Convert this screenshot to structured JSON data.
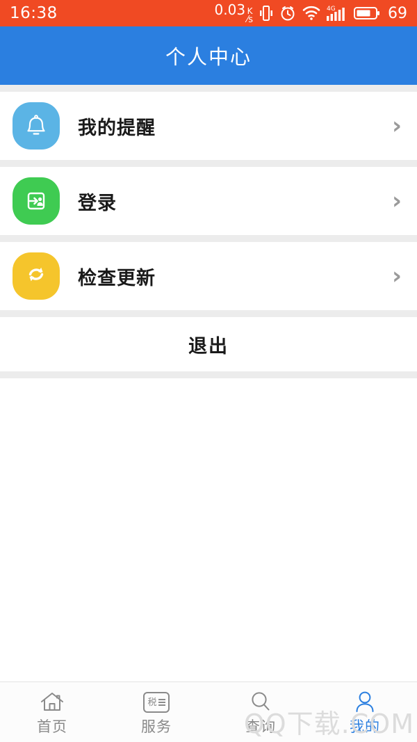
{
  "status_bar": {
    "time": "16:38",
    "network_speed_value": "0.03",
    "network_speed_unit_top": "K",
    "network_speed_unit_bottom": "s",
    "icons": [
      "vibrate-icon",
      "alarm-icon",
      "wifi-icon",
      "signal-4g-icon",
      "battery-icon"
    ],
    "signal_label": "4G",
    "battery_percent": "69",
    "background_color": "#F04A23",
    "text_color": "#FFFFFF"
  },
  "header": {
    "title": "个人中心",
    "background_color": "#2B7FE0",
    "text_color": "#FFFFFF"
  },
  "list": {
    "items": [
      {
        "label": "我的提醒",
        "icon": "bell-icon",
        "icon_color": "#5BB4E5",
        "chevron": "›"
      },
      {
        "label": "登录",
        "icon": "login-person-icon",
        "icon_color": "#3FCB52",
        "chevron": "›"
      },
      {
        "label": "检查更新",
        "icon": "refresh-icon",
        "icon_color": "#F5C52C",
        "chevron": "›"
      }
    ]
  },
  "logout": {
    "label": "退出"
  },
  "bottom_nav": {
    "active_index": 3,
    "active_color": "#2B7FE0",
    "inactive_color": "#8A8A8A",
    "items": [
      {
        "label": "首页",
        "icon": "home-icon"
      },
      {
        "label": "服务",
        "icon": "tax-card-icon",
        "icon_text": "税"
      },
      {
        "label": "查询",
        "icon": "search-icon"
      },
      {
        "label": "我的",
        "icon": "person-icon"
      }
    ]
  },
  "watermark": {
    "text": "QQ下载.COM"
  }
}
